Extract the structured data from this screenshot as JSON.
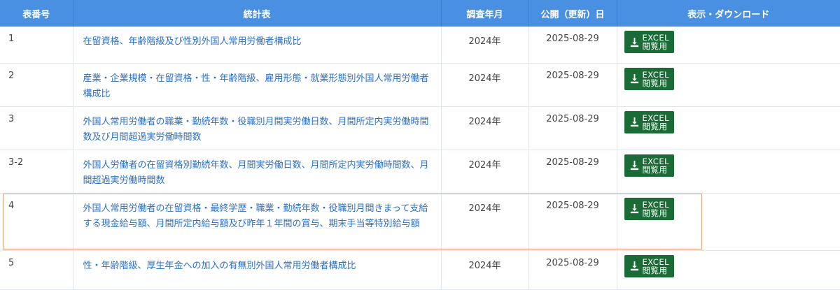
{
  "table": {
    "headers": {
      "number": "表番号",
      "title": "統計表",
      "survey_month": "調査年月",
      "published": "公開（更新）日",
      "download": "表示・ダウンロード"
    },
    "excel_label_1": "EXCEL",
    "excel_label_2": "閲覧用",
    "rows": [
      {
        "number": "1",
        "title": "在留資格、年齢階級及び性別外国人常用労働者構成比",
        "survey_month": "2024年",
        "published": "2025-08-29"
      },
      {
        "number": "2",
        "title": "産業・企業規模・在留資格・性・年齢階級、雇用形態・就業形態別外国人常用労働者構成比",
        "survey_month": "2024年",
        "published": "2025-08-29"
      },
      {
        "number": "3",
        "title": "外国人常用労働者の職業・勤続年数・役職別月間実労働日数、月間所定内実労働時間数及び月間超過実労働時間数",
        "survey_month": "2024年",
        "published": "2025-08-29"
      },
      {
        "number": "3-2",
        "title": "外国人労働者の在留資格別勤続年数、月間実労働日数、月間所定内実労働時間数、月間超過実労働時間数",
        "survey_month": "2024年",
        "published": "2025-08-29"
      },
      {
        "number": "4",
        "title": "外国人常用労働者の在留資格・最終学歴・職業・勤続年数・役職別月間きまって支給する現金給与額、月間所定内給与額及び昨年１年間の賞与、期末手当等特別給与額",
        "survey_month": "2024年",
        "published": "2025-08-29"
      },
      {
        "number": "5",
        "title": "性・年齢階級、厚生年金への加入の有無別外国人常用労働者構成比",
        "survey_month": "2024年",
        "published": "2025-08-29"
      }
    ]
  },
  "colors": {
    "header_bg": "#4a90e2",
    "link": "#2a6fc9",
    "excel_button": "#1a6b36",
    "highlight_border": "#f0a070"
  },
  "icons": {
    "download": "download-icon"
  }
}
